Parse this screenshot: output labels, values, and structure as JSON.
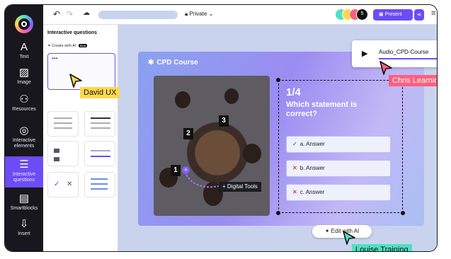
{
  "rail": {
    "items": [
      {
        "label": "Text",
        "icon": "A"
      },
      {
        "label": "Image",
        "icon": "▨"
      },
      {
        "label": "Resources",
        "icon": "⚇"
      },
      {
        "label": "Interactive elements",
        "icon": "◎"
      },
      {
        "label": "Interactive questions",
        "icon": "☰"
      },
      {
        "label": "Smartblocks",
        "icon": "▤"
      },
      {
        "label": "Insert",
        "icon": "⇩"
      }
    ]
  },
  "topbar": {
    "visibility": "Private",
    "avatar_count": "5",
    "present_label": "Present"
  },
  "panel": {
    "title": "Interactive questions",
    "create_ai": "Create with AI",
    "beta": "Beta",
    "input_value": "•••"
  },
  "slide": {
    "course_title": "CPD Course",
    "question_count": "1/4",
    "question_text": "Which statement is correct?",
    "answers": [
      {
        "mark": "✓",
        "text": "a. Answer",
        "color": "#2e9e4a"
      },
      {
        "mark": "✕",
        "text": "b. Answer",
        "color": "#e0443a"
      },
      {
        "mark": "✕",
        "text": "c. Answer",
        "color": "#e0443a"
      }
    ],
    "photo_numbers": [
      "3",
      "2",
      "1"
    ],
    "digital_tools": "Digital Tools",
    "edit_ai": "Edit with AI"
  },
  "audio": {
    "filename": "Audio_CPD-Course"
  },
  "collaborators": [
    {
      "name": "David UX",
      "color": "#ffd84a"
    },
    {
      "name": "Chris Learning",
      "color": "#ff5f7e"
    },
    {
      "name": "Louise Training",
      "color": "#4ee1c1"
    }
  ],
  "colors": {
    "accent": "#6c4cf5",
    "rail_bg": "#17171d",
    "canvas_bg": "#c9d3ee"
  }
}
